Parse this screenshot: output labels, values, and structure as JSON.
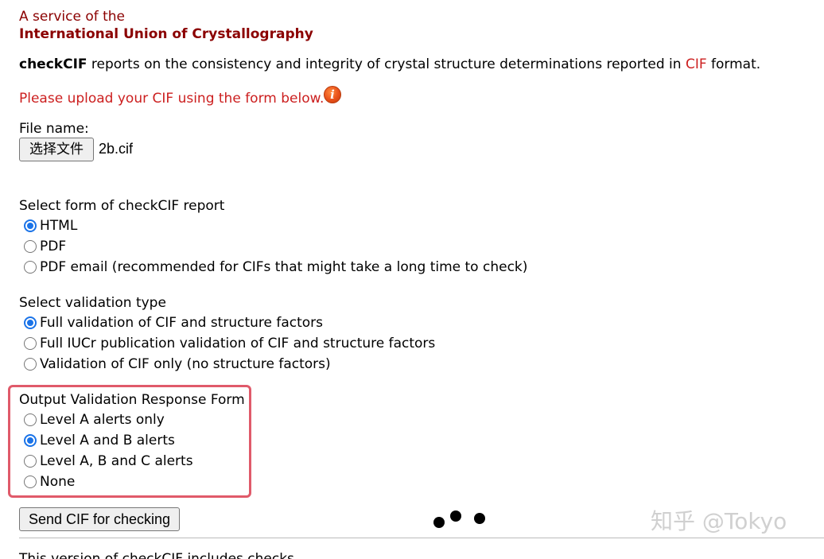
{
  "header": {
    "service_line": "A service of the",
    "organization": "International Union of Crystallography"
  },
  "intro": {
    "product": "checkCIF",
    "text_before": " reports on the consistency and integrity of crystal structure determinations reported in ",
    "cif_word": "CIF",
    "text_after": " format."
  },
  "upload": {
    "message": "Please upload your CIF using the form below.",
    "info_icon_glyph": "i"
  },
  "file": {
    "label": "File name:",
    "button_label": "选择文件",
    "chosen_file": "2b.cif"
  },
  "report_form": {
    "title": "Select form of checkCIF report",
    "options": [
      {
        "label": "HTML",
        "checked": true
      },
      {
        "label": "PDF",
        "checked": false
      },
      {
        "label": "PDF email (recommended for CIFs that might take a long time to check)",
        "checked": false
      }
    ]
  },
  "validation_type": {
    "title": "Select validation type",
    "options": [
      {
        "label": "Full validation of CIF and structure factors",
        "checked": true
      },
      {
        "label": "Full IUCr publication validation of CIF and structure factors",
        "checked": false
      },
      {
        "label": "Validation of CIF only (no structure factors)",
        "checked": false
      }
    ]
  },
  "response_form": {
    "title": "Output Validation Response Form",
    "options": [
      {
        "label": "Level A alerts only",
        "checked": false
      },
      {
        "label": "Level A and B alerts",
        "checked": true
      },
      {
        "label": "Level A, B and C alerts",
        "checked": false
      },
      {
        "label": "None",
        "checked": false
      }
    ]
  },
  "actions": {
    "send_label": "Send CIF for checking"
  },
  "footer": {
    "text": "This version of checkCIF includes checks"
  },
  "watermark": {
    "text": "知乎 @Tokyo"
  },
  "colors": {
    "brand_dark_red": "#8b0000",
    "message_red": "#cc1f1f",
    "radio_checked": "#1a73e8",
    "highlight_border": "#e05a6a"
  }
}
